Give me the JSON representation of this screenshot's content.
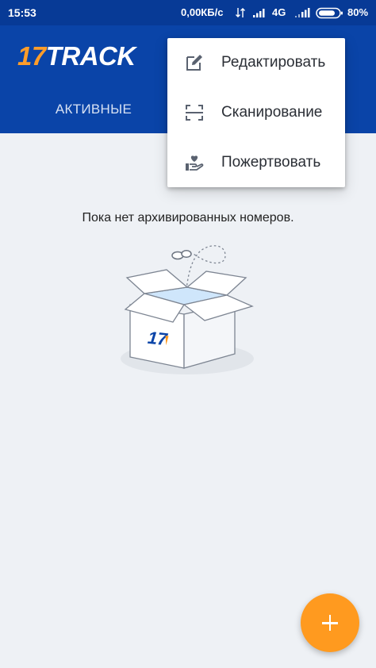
{
  "status_bar": {
    "time": "15:53",
    "speed": "0,00КБ/с",
    "network": "4G",
    "battery": "80%"
  },
  "app_bar": {
    "logo_number": "17",
    "logo_word": "TRACK",
    "active_tab_label": "АКТИВНЫЕ"
  },
  "menu": {
    "items": [
      {
        "label": "Редактировать",
        "icon": "edit-icon"
      },
      {
        "label": "Сканирование",
        "icon": "scan-icon"
      },
      {
        "label": "Пожертвовать",
        "icon": "donate-icon"
      }
    ]
  },
  "empty_state": {
    "message": "Пока нет архивированных номеров.",
    "box_logo": "17"
  },
  "fab": {
    "icon": "plus-icon"
  },
  "colors": {
    "brand_blue": "#0a44a8",
    "brand_orange": "#ff9a1f",
    "background": "#eef1f5"
  }
}
